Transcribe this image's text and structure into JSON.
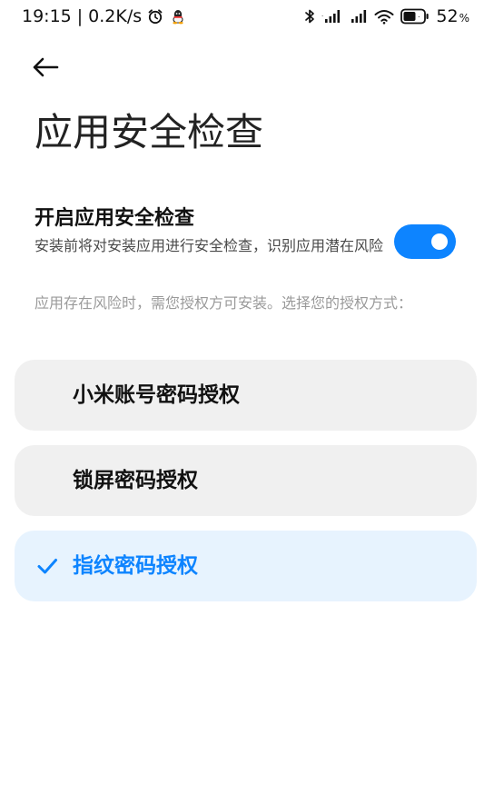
{
  "status_bar": {
    "time": "19:15",
    "separator": "|",
    "net_speed": "0.2K/s",
    "battery_level": "52",
    "battery_unit": "%",
    "icons": [
      "alarm-icon",
      "qq-icon",
      "bluetooth-icon",
      "signal-icon",
      "signal-icon",
      "wifi-icon",
      "battery-icon"
    ]
  },
  "header": {
    "back_icon": "back-arrow-icon",
    "title": "应用安全检查"
  },
  "setting": {
    "title": "开启应用安全检查",
    "description": "安装前将对安装应用进行安全检查，识别应用潜在风险",
    "enabled": true
  },
  "hint": "应用存在风险时，需您授权方可安装。选择您的授权方式：",
  "options": [
    {
      "label": "小米账号密码授权",
      "selected": false
    },
    {
      "label": "锁屏密码授权",
      "selected": false
    },
    {
      "label": "指纹密码授权",
      "selected": true
    }
  ],
  "colors": {
    "accent": "#0d84ff",
    "option_bg": "#f0f0f0",
    "selected_bg": "#e7f3fe",
    "hint_text": "#9a9a9a"
  }
}
